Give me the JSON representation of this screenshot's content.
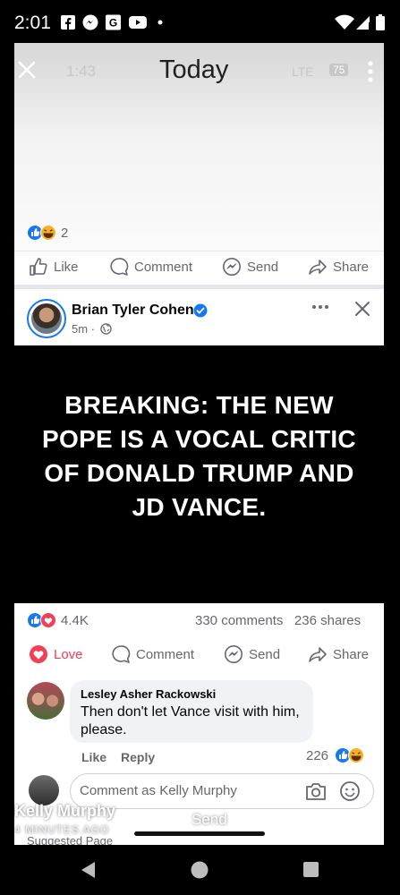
{
  "status_bar": {
    "time": "2:01"
  },
  "story": {
    "screenshot_status": {
      "time": "1:43",
      "title": "Today",
      "network": "LTE",
      "battery": "75"
    },
    "top_post": {
      "reaction_count": "2",
      "actions": {
        "like": "Like",
        "comment": "Comment",
        "send": "Send",
        "share": "Share"
      }
    },
    "post": {
      "author": "Brian Tyler Cohen",
      "time": "5m ·",
      "headline": "BREAKING: THE NEW POPE IS A VOCAL CRITIC OF DONALD TRUMP AND JD VANCE.",
      "reaction_count": "4.4K",
      "comments_count": "330 comments",
      "shares_count": "236 shares",
      "actions": {
        "love": "Love",
        "comment": "Comment",
        "send": "Send",
        "share": "Share"
      }
    },
    "comment": {
      "author": "Lesley Asher Rackowski",
      "text": "Then don't let Vance visit with him, please.",
      "like": "Like",
      "reply": "Reply",
      "reaction_count": "226"
    },
    "composer": {
      "placeholder": "Comment as Kelly Murphy"
    },
    "suggested": "Suggested Page",
    "overlay": {
      "name": "Kelly Murphy",
      "time": "4 MINUTES AGO",
      "send": "Send"
    }
  },
  "colors": {
    "facebook_blue": "#1877f2",
    "love_red": "#f33e58",
    "haha_yellow": "#f7b125"
  }
}
